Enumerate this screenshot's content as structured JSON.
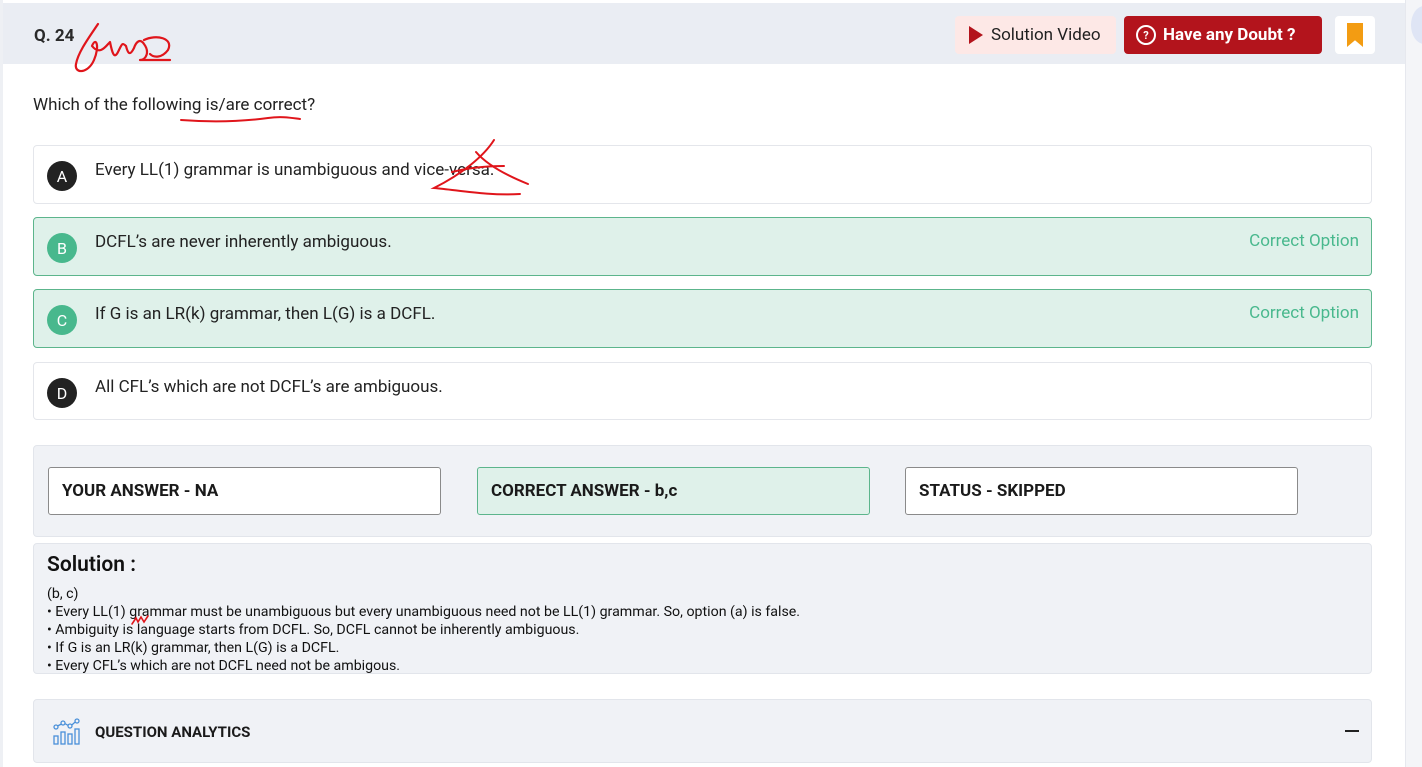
{
  "question": {
    "number": "Q. 24",
    "text": "Which of the following is/are correct?"
  },
  "header": {
    "solution_video_label": "Solution Video",
    "doubt_label": "Have any Doubt ?",
    "bookmark_icon": "bookmark-icon"
  },
  "options": [
    {
      "key": "A",
      "text": "Every LL(1) grammar is unambiguous and vice-versa.",
      "tag": ""
    },
    {
      "key": "B",
      "text": "DCFL’s are never inherently ambiguous.",
      "tag": "Correct Option"
    },
    {
      "key": "C",
      "text": "If G is an LR(k) grammar, then L(G) is a DCFL.",
      "tag": "Correct Option"
    },
    {
      "key": "D",
      "text": "All CFL’s which are not DCFL’s are ambiguous.",
      "tag": ""
    }
  ],
  "answers": {
    "yours": "YOUR ANSWER - NA",
    "correct": "CORRECT ANSWER - b,c",
    "status": "STATUS - SKIPPED"
  },
  "solution": {
    "title": "Solution :",
    "lines": [
      "(b, c)",
      "• Every LL(1) grammar must be unambiguous but every unambiguous need not be LL(1) grammar. So, option (a) is false.",
      "• Ambiguity is language starts from DCFL. So, DCFL cannot be inherently ambiguous.",
      "• If G is an LR(k) grammar, then L(G) is a DCFL.",
      "• Every CFL’s which are not DCFL need not be ambigous."
    ]
  },
  "analytics": {
    "title": "QUESTION ANALYTICS"
  },
  "colors": {
    "brand_red": "#b3141c",
    "correct_green": "#48b88d",
    "bookmark_orange": "#f39c12"
  }
}
